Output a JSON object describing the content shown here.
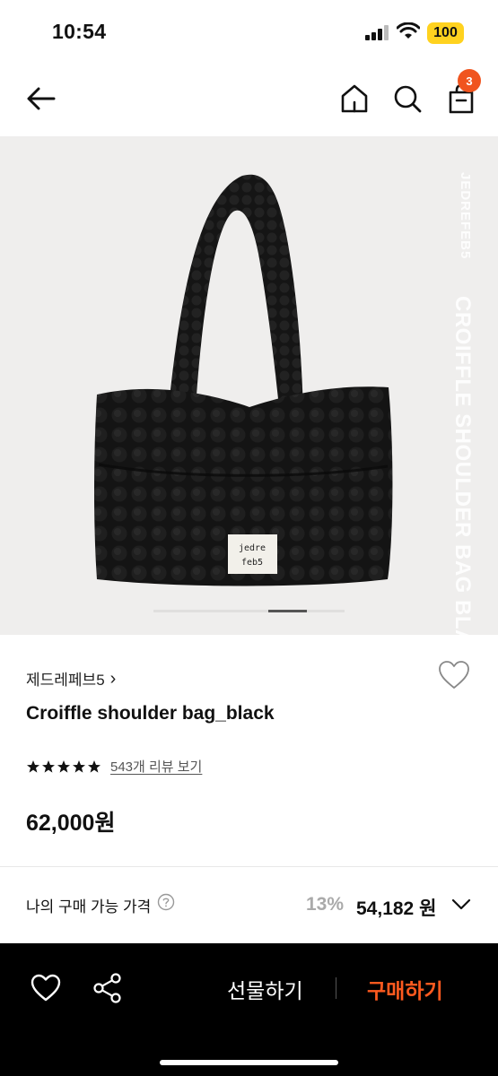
{
  "status_bar": {
    "time": "10:54",
    "battery": "100",
    "battery_color": "#ffd21f"
  },
  "nav": {
    "back_icon": "arrow-left-icon",
    "home_icon": "home-icon",
    "search_icon": "search-icon",
    "cart_icon": "shopping-bag-icon",
    "cart_count": "3",
    "badge_color": "#f0541e"
  },
  "hero": {
    "side_brand": "JEDREFEB5",
    "side_title": "CROIFFLE SHOULDER BAG BLACK",
    "label_line1": "jedre",
    "label_line2": "feb5",
    "pager_total": 5,
    "pager_active": 3
  },
  "product": {
    "brand": "제드레페브5",
    "brand_chevron": "›",
    "name": "Croiffle shoulder bag_black",
    "rating_stars": 5,
    "review_link": "543개 리뷰 보기",
    "price": "62,000원"
  },
  "my_price": {
    "label": "나의 구매 가능 가격",
    "help_icon": "question-circle-icon",
    "discount": "13%",
    "final_price": "54,182 원",
    "chevron_icon": "chevron-down-icon"
  },
  "bottom_bar": {
    "wish_icon": "heart-outline-icon",
    "share_icon": "share-icon",
    "gift_label": "선물하기",
    "buy_label": "구매하기",
    "buy_color": "#ff5a1f"
  }
}
